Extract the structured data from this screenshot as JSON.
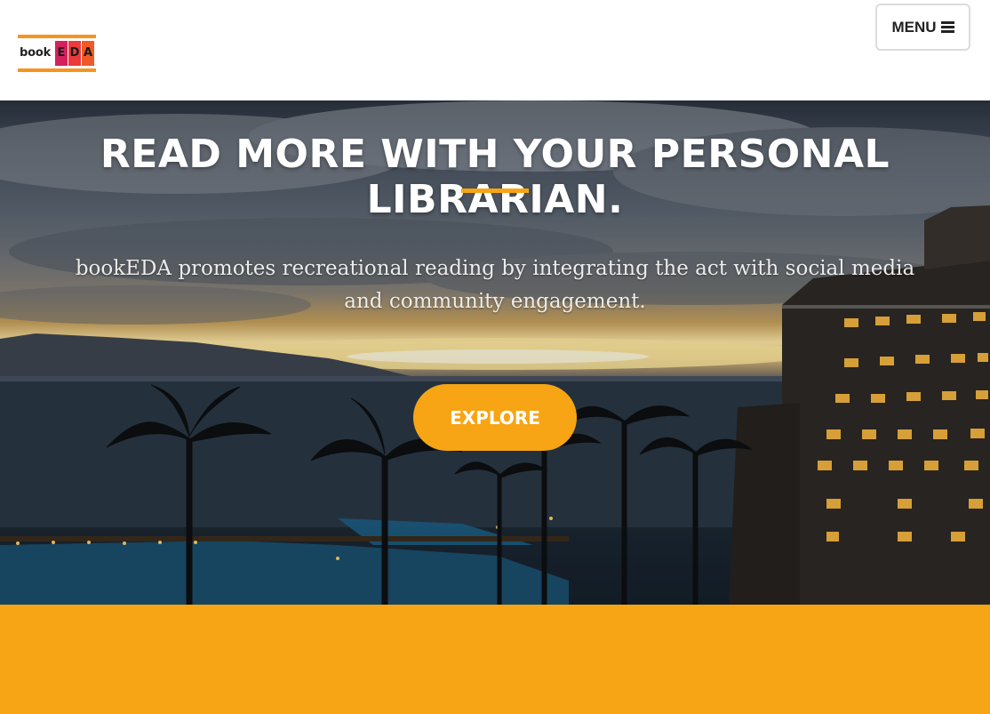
{
  "logo": {
    "word": "book",
    "letters": [
      "E",
      "D",
      "A"
    ],
    "colors": {
      "bar": "#f7941d",
      "e": "#d6205e",
      "d": "#ea3a3a",
      "a": "#f05a28"
    }
  },
  "nav": {
    "menu_label": "MENU",
    "menu_icon": "hamburger-icon"
  },
  "hero": {
    "title": "READ MORE WITH YOUR PERSONAL LIBRARIAN.",
    "subtitle": "bookEDA promotes recreational reading by integrating the act with social media and community engagement.",
    "button_label": "EXPLORE",
    "background_image": "sunset-resort-photo"
  },
  "theme": {
    "accent": "#f7a515",
    "text_light": "#ffffff"
  }
}
